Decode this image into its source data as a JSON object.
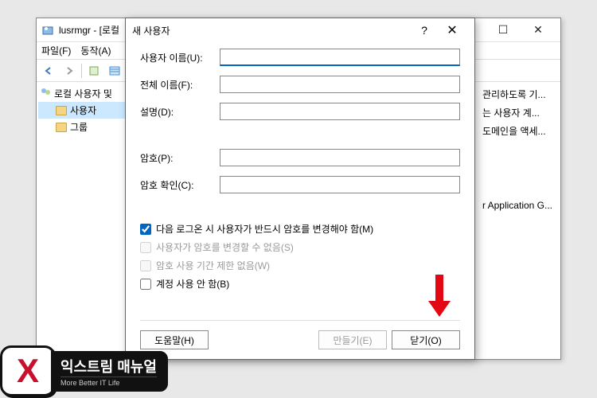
{
  "main_window": {
    "title": "lusrmgr - [로컬",
    "menu": {
      "file": "파일(F)",
      "action": "동작(A)"
    },
    "tree": {
      "root": "로컬 사용자 및",
      "users": "사용자",
      "groups": "그룹"
    },
    "content_rows": [
      "관리하도록 기...",
      "는 사용자 계...",
      "도메인을 액세...",
      "r Application G..."
    ]
  },
  "dialog": {
    "title": "새 사용자",
    "fields": {
      "username_label": "사용자 이름(U):",
      "fullname_label": "전체 이름(F):",
      "desc_label": "설명(D):",
      "password_label": "암호(P):",
      "confirm_label": "암호 확인(C):",
      "username_value": "",
      "fullname_value": "",
      "desc_value": "",
      "password_value": "",
      "confirm_value": ""
    },
    "checkboxes": {
      "must_change": "다음 로그온 시 사용자가 반드시 암호를 변경해야 함(M)",
      "cannot_change": "사용자가 암호를 변경할 수 없음(S)",
      "never_expires": "암호 사용 기간 제한 없음(W)",
      "disabled": "계정 사용 안 함(B)",
      "must_change_checked": true,
      "cannot_change_checked": false,
      "never_expires_checked": false,
      "disabled_checked": false
    },
    "buttons": {
      "help": "도움말(H)",
      "create": "만들기(E)",
      "close": "닫기(O)"
    }
  },
  "logo": {
    "brand": "익스트림 매뉴얼",
    "tagline": "More Better IT Life"
  }
}
